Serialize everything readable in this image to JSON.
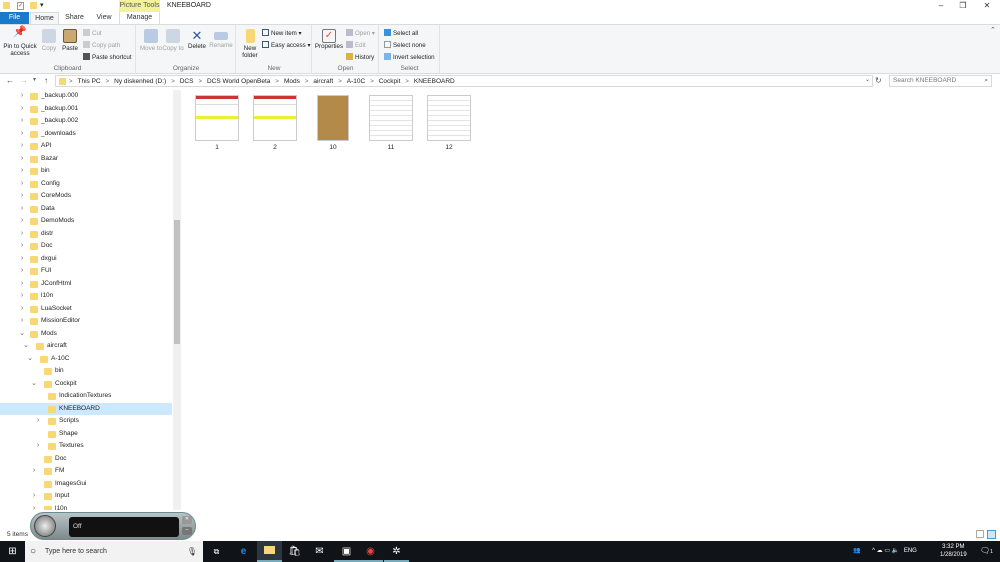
{
  "window": {
    "title": "KNEEBOARD",
    "context_tab": "Picture Tools",
    "context_tab_sub": "Manage"
  },
  "tabs": [
    "File",
    "Home",
    "Share",
    "View"
  ],
  "ribbon": {
    "clipboard": {
      "label": "Clipboard",
      "pin": "Pin to Quick access",
      "copy": "Copy",
      "paste": "Paste",
      "cut": "Cut",
      "copy_path": "Copy path",
      "paste_shortcut": "Paste shortcut"
    },
    "organize": {
      "label": "Organize",
      "move_to": "Move to",
      "copy_to": "Copy to",
      "delete": "Delete",
      "rename": "Rename"
    },
    "new": {
      "label": "New",
      "new_folder": "New folder",
      "new_item": "New item",
      "easy_access": "Easy access"
    },
    "open": {
      "label": "Open",
      "properties": "Properties",
      "open": "Open",
      "edit": "Edit",
      "history": "History"
    },
    "select": {
      "label": "Select",
      "select_all": "Select all",
      "select_none": "Select none",
      "invert": "Invert selection"
    }
  },
  "breadcrumb": [
    "This PC",
    "Ny diskenhed (D:)",
    "DCS",
    "DCS World OpenBeta",
    "Mods",
    "aircraft",
    "A-10C",
    "Cockpit",
    "KNEEBOARD"
  ],
  "search_placeholder": "Search KNEEBOARD",
  "tree": [
    {
      "label": "_backup.000",
      "level": 1,
      "chev": ">"
    },
    {
      "label": "_backup.001",
      "level": 1,
      "chev": ">"
    },
    {
      "label": "_backup.002",
      "level": 1,
      "chev": ">"
    },
    {
      "label": "_downloads",
      "level": 1,
      "chev": ">"
    },
    {
      "label": "API",
      "level": 1,
      "chev": ">"
    },
    {
      "label": "Bazar",
      "level": 1,
      "chev": ">"
    },
    {
      "label": "bin",
      "level": 1,
      "chev": ">"
    },
    {
      "label": "Config",
      "level": 1,
      "chev": ">"
    },
    {
      "label": "CoreMods",
      "level": 1,
      "chev": ">"
    },
    {
      "label": "Data",
      "level": 1,
      "chev": ">"
    },
    {
      "label": "DemoMods",
      "level": 1,
      "chev": ">"
    },
    {
      "label": "distr",
      "level": 1,
      "chev": ">"
    },
    {
      "label": "Doc",
      "level": 1,
      "chev": ">"
    },
    {
      "label": "dxgui",
      "level": 1,
      "chev": ">"
    },
    {
      "label": "FUI",
      "level": 1,
      "chev": ">"
    },
    {
      "label": "JConfHtml",
      "level": 1,
      "chev": ">"
    },
    {
      "label": "l10n",
      "level": 1,
      "chev": ">"
    },
    {
      "label": "LuaSocket",
      "level": 1,
      "chev": ">"
    },
    {
      "label": "MissionEditor",
      "level": 1,
      "chev": ">"
    },
    {
      "label": "Mods",
      "level": 1,
      "chev": "v"
    },
    {
      "label": "aircraft",
      "level": 2,
      "chev": "v"
    },
    {
      "label": "A-10C",
      "level": 3,
      "chev": "v"
    },
    {
      "label": "bin",
      "level": 4,
      "chev": ""
    },
    {
      "label": "Cockpit",
      "level": 4,
      "chev": "v"
    },
    {
      "label": "IndicationTextures",
      "level": 5,
      "chev": ""
    },
    {
      "label": "KNEEBOARD",
      "level": 5,
      "chev": "",
      "selected": true
    },
    {
      "label": "Scripts",
      "level": 5,
      "chev": ">"
    },
    {
      "label": "Shape",
      "level": 5,
      "chev": ""
    },
    {
      "label": "Textures",
      "level": 5,
      "chev": ">"
    },
    {
      "label": "Doc",
      "level": 4,
      "chev": ""
    },
    {
      "label": "FM",
      "level": 4,
      "chev": ">"
    },
    {
      "label": "ImagesGui",
      "level": 4,
      "chev": ""
    },
    {
      "label": "Input",
      "level": 4,
      "chev": ">"
    },
    {
      "label": "l10n",
      "level": 4,
      "chev": ">"
    }
  ],
  "files": [
    {
      "name": "1",
      "kind": "chart"
    },
    {
      "name": "2",
      "kind": "chart"
    },
    {
      "name": "10",
      "kind": "map"
    },
    {
      "name": "11",
      "kind": "doc"
    },
    {
      "name": "12",
      "kind": "doc"
    }
  ],
  "status": "5 items",
  "speech": {
    "state": "Off"
  },
  "taskbar": {
    "search_placeholder": "Type here to search",
    "time": "3:32 PM",
    "date": "1/28/2019",
    "lang": "ENG",
    "notifications": "1"
  }
}
